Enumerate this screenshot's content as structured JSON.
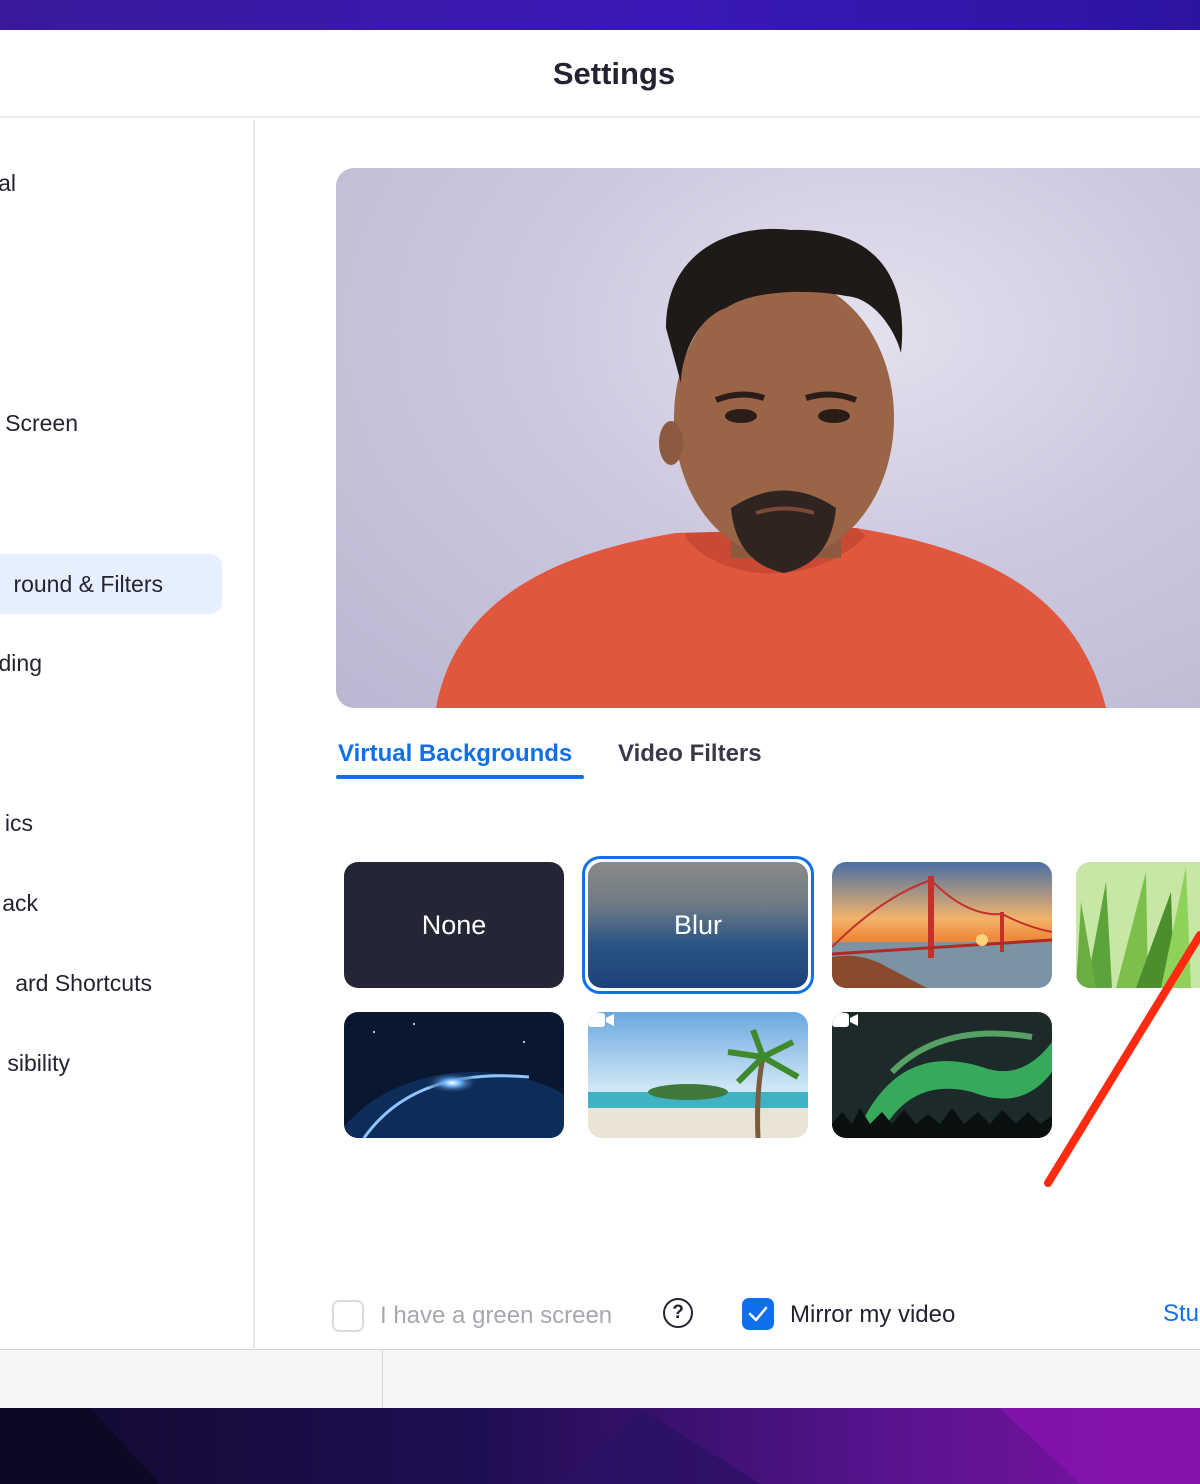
{
  "window": {
    "title": "Settings"
  },
  "sidebar": {
    "items": [
      {
        "label": "General",
        "visible_text": "al"
      },
      {
        "label": "Share Screen",
        "visible_text": "Screen"
      },
      {
        "label": "Background & Filters",
        "visible_text": "round & Filters",
        "active": true
      },
      {
        "label": "Recording",
        "visible_text": "ding"
      },
      {
        "label": "Statistics",
        "visible_text": "ics"
      },
      {
        "label": "Feedback",
        "visible_text": "ack"
      },
      {
        "label": "Keyboard Shortcuts",
        "visible_text": "ard Shortcuts"
      },
      {
        "label": "Accessibility",
        "visible_text": "sibility"
      }
    ]
  },
  "tabs": [
    {
      "label": "Virtual Backgrounds",
      "active": true
    },
    {
      "label": "Video Filters",
      "active": false
    }
  ],
  "backgrounds": [
    {
      "name": "None",
      "label": "None",
      "selected": false
    },
    {
      "name": "Blur",
      "label": "Blur",
      "selected": true
    },
    {
      "name": "golden-gate",
      "label": "",
      "selected": false
    },
    {
      "name": "grass",
      "label": "",
      "selected": false
    },
    {
      "name": "earth-space",
      "label": "",
      "selected": false
    },
    {
      "name": "beach",
      "label": "",
      "selected": false,
      "video": true
    },
    {
      "name": "aurora",
      "label": "",
      "selected": false,
      "video": true
    }
  ],
  "options": {
    "green_screen": {
      "label": "I have a green screen",
      "checked": false,
      "enabled": false
    },
    "help_icon": "?",
    "mirror_video": {
      "label": "Mirror my video",
      "checked": true
    },
    "studio_effects_link": "Stu"
  },
  "colors": {
    "accent": "#0e71eb",
    "annotation_arrow": "#ff2a10"
  }
}
